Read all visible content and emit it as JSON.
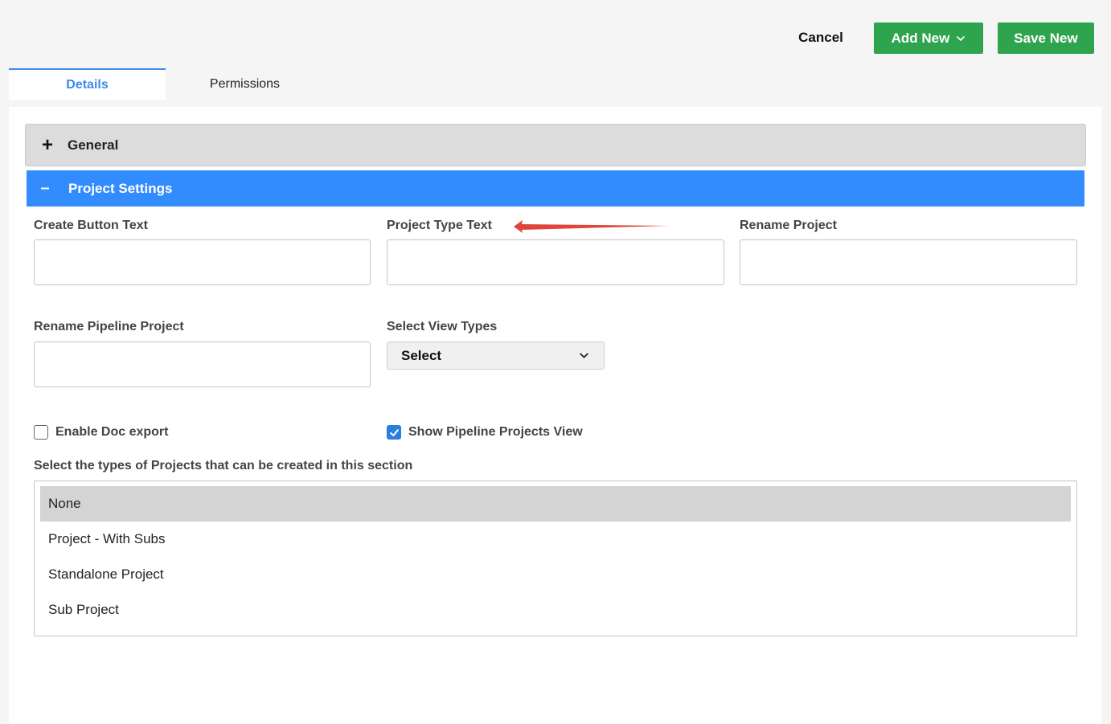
{
  "actions": {
    "cancel_label": "Cancel",
    "add_new_label": "Add New",
    "save_new_label": "Save New"
  },
  "tabs": [
    {
      "label": "Details",
      "active": true
    },
    {
      "label": "Permissions",
      "active": false
    }
  ],
  "sections": {
    "general": {
      "icon": "plus-icon",
      "title": "General",
      "expanded": false
    },
    "project_settings": {
      "icon": "minus-icon",
      "title": "Project Settings",
      "expanded": true
    }
  },
  "fields": {
    "create_button_text": {
      "label": "Create Button Text",
      "value": ""
    },
    "project_type_text": {
      "label": "Project Type Text",
      "value": ""
    },
    "rename_project": {
      "label": "Rename Project",
      "value": ""
    },
    "rename_pipeline_project": {
      "label": "Rename Pipeline Project",
      "value": ""
    },
    "select_view_types": {
      "label": "Select View Types",
      "value": "Select"
    }
  },
  "checkboxes": {
    "enable_doc_export": {
      "label": "Enable Doc export",
      "checked": false
    },
    "show_pipeline_projects_view": {
      "label": "Show Pipeline Projects View",
      "checked": true
    }
  },
  "project_types": {
    "label": "Select the types of Projects that can be created in this section",
    "options": [
      "None",
      "Project - With Subs",
      "Standalone Project",
      "Sub Project"
    ],
    "selected": "None"
  },
  "colors": {
    "primary_green": "#2ea44f",
    "accent_blue": "#338cfd",
    "annotation_arrow": "#e0443a"
  }
}
